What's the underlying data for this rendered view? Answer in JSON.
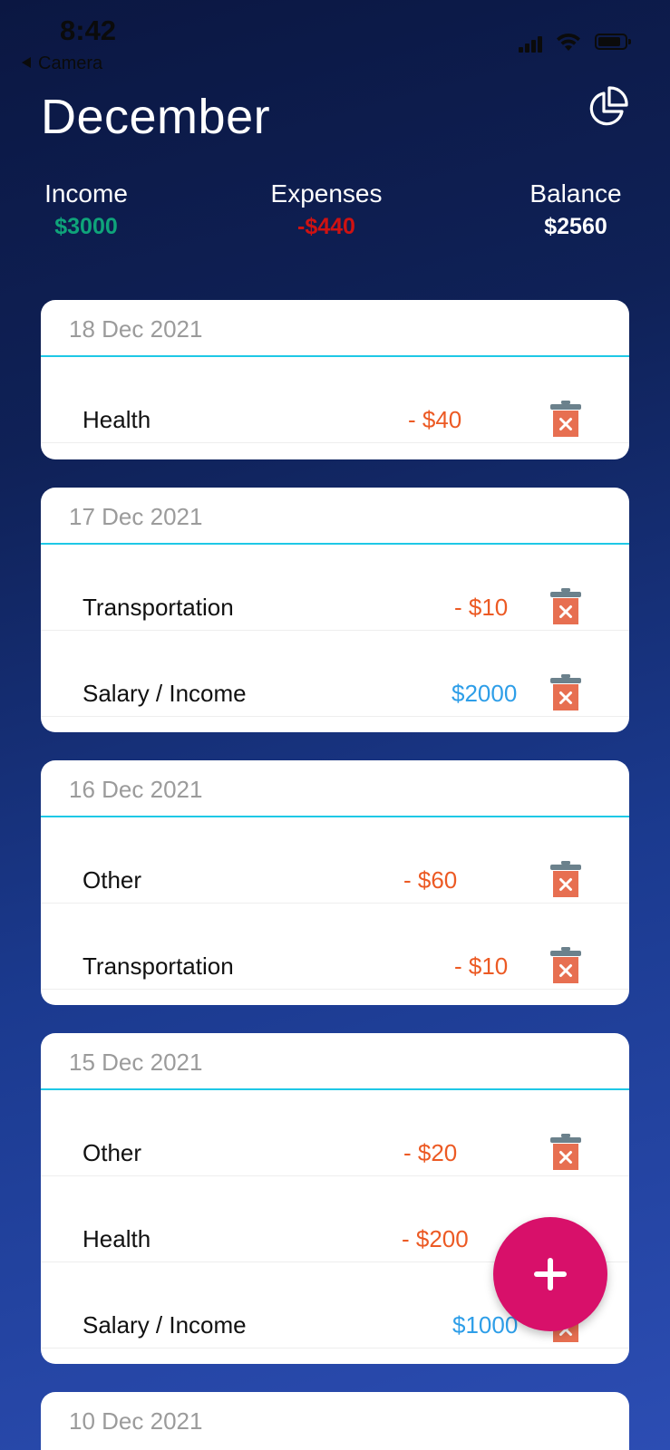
{
  "status_bar": {
    "time": "8:42",
    "back_label": "Camera"
  },
  "header": {
    "month": "December",
    "chart_icon": "pie-chart-icon"
  },
  "summary": {
    "income_label": "Income",
    "income_value": "$3000",
    "expenses_label": "Expenses",
    "expenses_value": "-$440",
    "balance_label": "Balance",
    "balance_value": "$2560"
  },
  "colors": {
    "income": "#0fa47a",
    "expenses": "#cf1212",
    "balance": "#ffffff",
    "expense_amount": "#ec5a24",
    "income_amount": "#2e9ee8",
    "divider": "#1ec8e6",
    "fab": "#d8106a"
  },
  "days": [
    {
      "date": "18 Dec 2021",
      "entries": [
        {
          "category": "Health",
          "amount": "- $40",
          "type": "expense"
        }
      ]
    },
    {
      "date": "17 Dec 2021",
      "entries": [
        {
          "category": "Transportation",
          "amount": "- $10",
          "type": "expense"
        },
        {
          "category": "Salary / Income",
          "amount": "$2000",
          "type": "income"
        }
      ]
    },
    {
      "date": "16 Dec 2021",
      "entries": [
        {
          "category": "Other",
          "amount": "- $60",
          "type": "expense"
        },
        {
          "category": "Transportation",
          "amount": "- $10",
          "type": "expense"
        }
      ]
    },
    {
      "date": "15 Dec 2021",
      "entries": [
        {
          "category": "Other",
          "amount": "- $20",
          "type": "expense"
        },
        {
          "category": "Health",
          "amount": "- $200",
          "type": "expense"
        },
        {
          "category": "Salary / Income",
          "amount": "$1000",
          "type": "income"
        }
      ]
    },
    {
      "date": "10 Dec 2021",
      "entries": []
    }
  ],
  "fab_icon": "plus-icon",
  "delete_icon": "trash-icon"
}
